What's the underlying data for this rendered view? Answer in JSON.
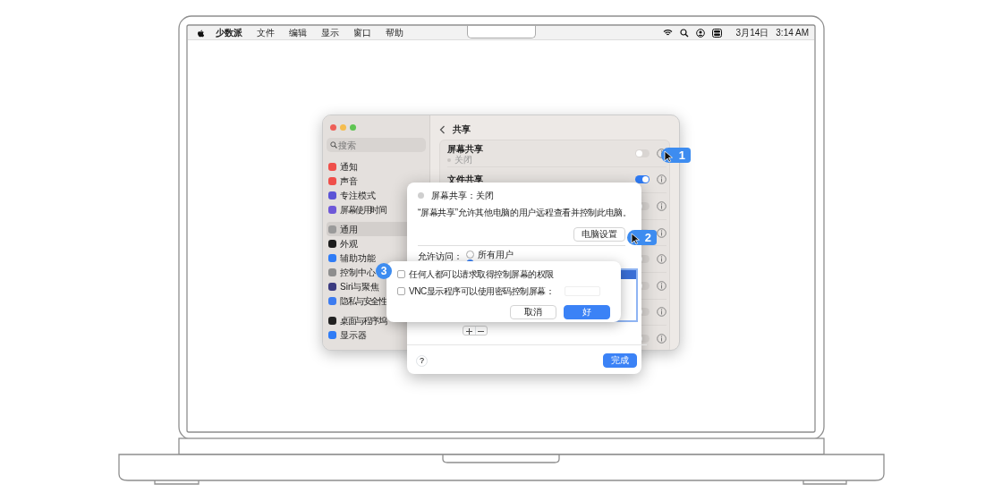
{
  "menu_bar": {
    "app": "少数派",
    "menus": [
      "文件",
      "编辑",
      "显示",
      "窗口",
      "帮助"
    ],
    "date": "3月14日",
    "time": "3:14 AM"
  },
  "settings": {
    "search": {
      "placeholder": "搜索"
    },
    "sidebar": {
      "groups": [
        [
          {
            "label": "通知",
            "color": "#ef4f4a",
            "selected": false
          },
          {
            "label": "声音",
            "color": "#ef4f4a",
            "selected": false
          },
          {
            "label": "专注模式",
            "color": "#5b54d6",
            "selected": false
          },
          {
            "label": "屏幕使用时间",
            "color": "#6e58d8",
            "selected": false
          }
        ],
        [
          {
            "label": "通用",
            "color": "#9a9a9a",
            "selected": true
          },
          {
            "label": "外观",
            "color": "#1d1d1d",
            "selected": false
          },
          {
            "label": "辅助功能",
            "color": "#2f7cf6",
            "selected": false
          },
          {
            "label": "控制中心",
            "color": "#8e8e8e",
            "selected": false
          },
          {
            "label": "Siri与聚焦",
            "color": "#3b3b80",
            "selected": false
          },
          {
            "label": "隐私与安全性",
            "color": "#3d7cf0",
            "selected": false
          }
        ],
        [
          {
            "label": "桌面与程序坞",
            "color": "#222222",
            "selected": false
          },
          {
            "label": "显示器",
            "color": "#2f7cf6",
            "selected": false
          }
        ]
      ]
    },
    "title": "共享",
    "rows": [
      {
        "label": "屏幕共享",
        "status": "关闭",
        "on": false
      },
      {
        "label": "文件共享",
        "on": true
      },
      {
        "on": false
      },
      {
        "on": false
      },
      {
        "on": false
      },
      {
        "on": false
      },
      {
        "on": false
      },
      {
        "on": false
      }
    ]
  },
  "dialog": {
    "title": "屏幕共享：关闭",
    "on": false,
    "description": "“屏幕共享”允许其他电脑的用户远程查看并控制此电脑。",
    "settings_button": "电脑设置",
    "access_label": "允许访问：",
    "radios": [
      {
        "label": "所有用户",
        "selected": false
      },
      {
        "selected": true
      }
    ],
    "help": "?",
    "done": "完成"
  },
  "sheet": {
    "checkboxes": [
      {
        "label": "任何人都可以请求取得控制屏幕的权限",
        "checked": false
      },
      {
        "label": "VNC显示程序可以使用密码控制屏幕：",
        "checked": false
      }
    ],
    "buttons": [
      {
        "label": "取消",
        "kind": "secondary"
      },
      {
        "label": "好",
        "kind": "primary"
      }
    ]
  },
  "callouts": [
    "1",
    "2",
    "3"
  ]
}
